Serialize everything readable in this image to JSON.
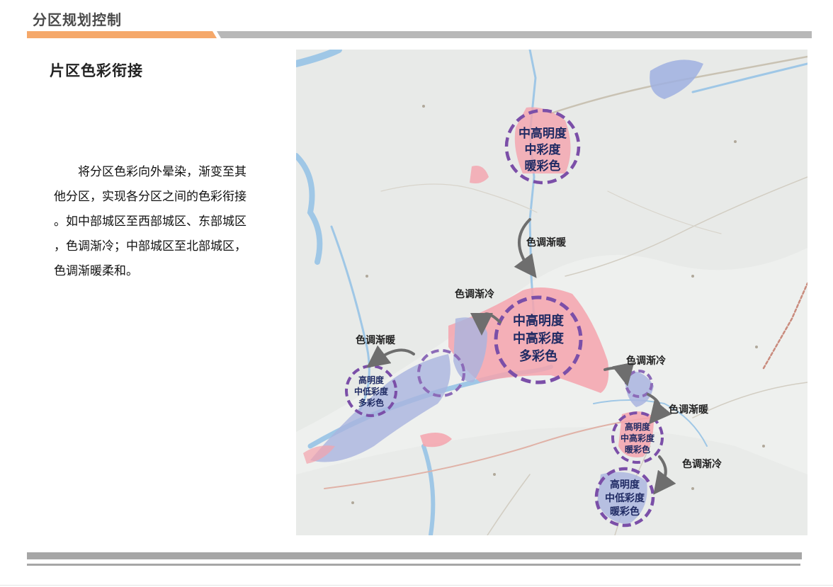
{
  "header": {
    "title": "分区规划控制"
  },
  "section": {
    "subtitle": "片区色彩衔接"
  },
  "body": {
    "paragraph_lines": [
      "　　将分区色彩向外晕染，渐变至其",
      "他分区，实现各分区之间的色彩衔接",
      "。如中部城区至西部城区、东部城区",
      "，色调渐冷；中部城区至北部城区，",
      "色调渐暖柔和。"
    ]
  },
  "colors": {
    "accent_orange": "#f5a86a",
    "bar_gray": "#a6a6a6",
    "circle_purple": "#7b4fa8",
    "label_navy": "#1f2a63",
    "zone_pink": "#f4a3ad",
    "zone_blue": "#a9b4df"
  },
  "map": {
    "zones": [
      {
        "lines": [
          "中高明度",
          "中彩度",
          "暖彩色"
        ]
      },
      {
        "lines": [
          "中高明度",
          "中高彩度",
          "多彩色"
        ]
      },
      {
        "lines": [
          "高明度",
          "中低彩度",
          "多彩色"
        ]
      },
      {
        "lines": [
          "高明度",
          "中高彩度",
          "暖彩色"
        ]
      },
      {
        "lines": [
          "高明度",
          "中低彩度",
          "暖彩色"
        ]
      }
    ],
    "transitions": [
      "色调渐暖",
      "色调渐冷",
      "色调渐暖",
      "色调渐冷",
      "色调渐暖",
      "色调渐冷"
    ]
  }
}
